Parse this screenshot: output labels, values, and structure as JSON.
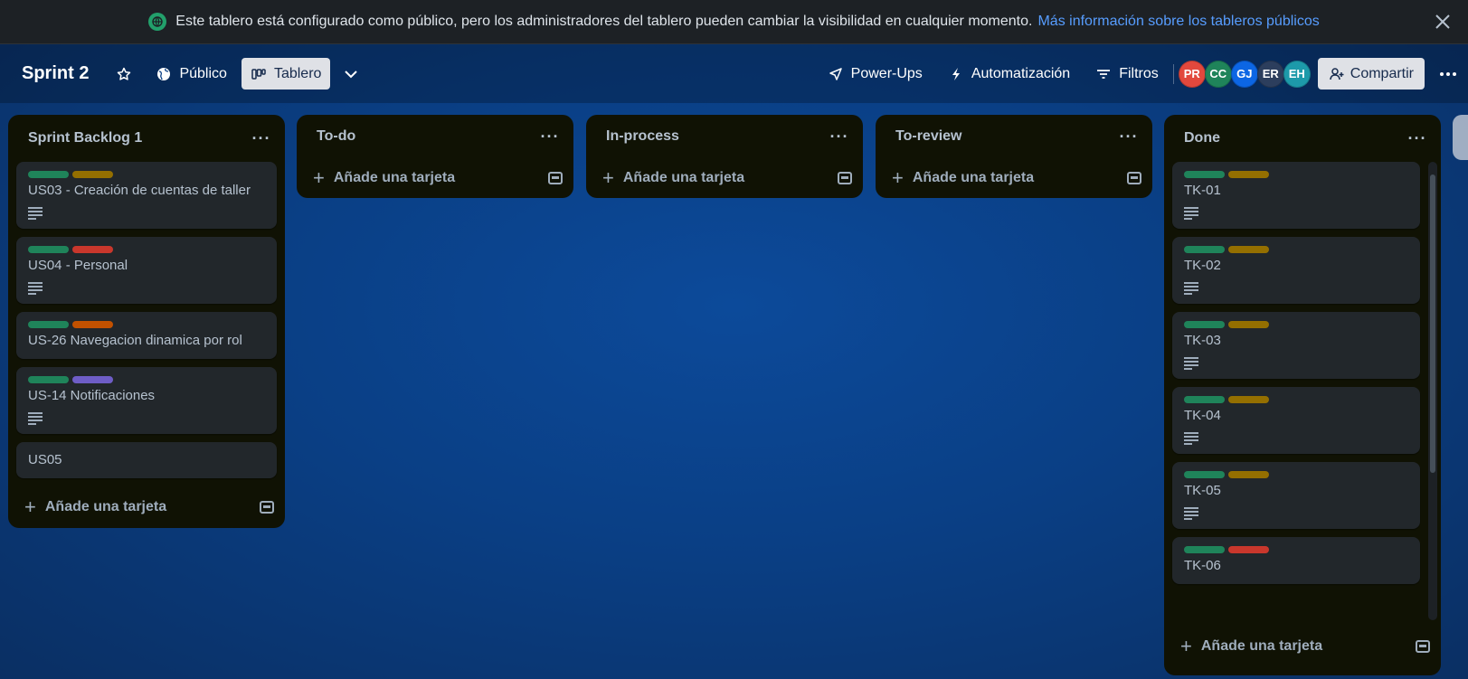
{
  "banner": {
    "message": "Este tablero está configurado como público, pero los administradores del tablero pueden cambiar la visibilidad en cualquier momento.",
    "link": "Más información sobre los tableros públicos",
    "close_icon": "close-icon"
  },
  "header": {
    "board_title": "Sprint 2",
    "visibility": "Público",
    "view": "Tablero",
    "power_ups": "Power-Ups",
    "automation": "Automatización",
    "filters": "Filtros",
    "share": "Compartir",
    "members": [
      {
        "initials": "PR",
        "color": "#e2483d"
      },
      {
        "initials": "CC",
        "color": "#1f845a"
      },
      {
        "initials": "GJ",
        "color": "#0c66e4"
      },
      {
        "initials": "ER",
        "color": "#2c3e5d"
      },
      {
        "initials": "EH",
        "color": "#1d9aaa"
      }
    ]
  },
  "label_colors": {
    "green": "#1f845a",
    "yellow": "#946f00",
    "red": "#c9372c",
    "orange": "#c25100",
    "purple": "#6e5dc6"
  },
  "add_card_label": "Añade una tarjeta",
  "lists": [
    {
      "title": "Sprint Backlog 1",
      "cards": [
        {
          "title": "US03 - Creación de cuentas de taller",
          "labels": [
            "green",
            "yellow"
          ],
          "has_description": true
        },
        {
          "title": "US04 - Personal",
          "labels": [
            "green",
            "red"
          ],
          "has_description": true
        },
        {
          "title": "US-26 Navegacion dinamica por rol",
          "labels": [
            "green",
            "orange"
          ],
          "has_description": false
        },
        {
          "title": "US-14 Notificaciones",
          "labels": [
            "green",
            "purple"
          ],
          "has_description": true
        },
        {
          "title": "US05",
          "labels": [],
          "has_description": false
        }
      ]
    },
    {
      "title": "To-do",
      "cards": []
    },
    {
      "title": "In-process",
      "cards": []
    },
    {
      "title": "To-review",
      "cards": []
    },
    {
      "title": "Done",
      "cards": [
        {
          "title": "TK-01",
          "labels": [
            "green",
            "yellow"
          ],
          "has_description": true
        },
        {
          "title": "TK-02",
          "labels": [
            "green",
            "yellow"
          ],
          "has_description": true
        },
        {
          "title": "TK-03",
          "labels": [
            "green",
            "yellow"
          ],
          "has_description": true
        },
        {
          "title": "TK-04",
          "labels": [
            "green",
            "yellow"
          ],
          "has_description": true
        },
        {
          "title": "TK-05",
          "labels": [
            "green",
            "yellow"
          ],
          "has_description": true
        },
        {
          "title": "TK-06",
          "labels": [
            "green",
            "red"
          ],
          "has_description": false
        }
      ]
    }
  ]
}
